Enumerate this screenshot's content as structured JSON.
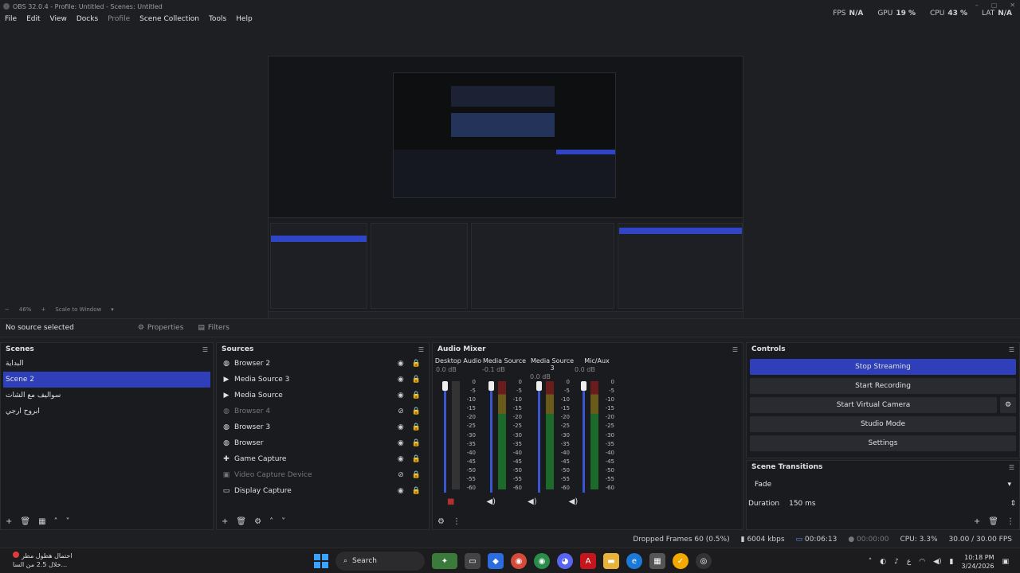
{
  "window": {
    "title": "OBS 32.0.4 - Profile: Untitled - Scenes: Untitled",
    "controls": [
      "–",
      "▢",
      "✕"
    ]
  },
  "menu": [
    "File",
    "Edit",
    "View",
    "Docks",
    "Profile",
    "Scene Collection",
    "Tools",
    "Help"
  ],
  "stats": [
    {
      "key": "FPS",
      "value": "N/A"
    },
    {
      "key": "GPU",
      "value": "19 %"
    },
    {
      "key": "CPU",
      "value": "43 %"
    },
    {
      "key": "LAT",
      "value": "N/A"
    }
  ],
  "scale": {
    "zoom": "46%",
    "mode": "Scale to Window"
  },
  "source_bar": {
    "selected": "No source selected",
    "properties": "Properties",
    "filters": "Filters"
  },
  "scenes": {
    "title": "Scenes",
    "items": [
      "البداية",
      "Scene 2",
      "سواليف مع الشات",
      "ابروح ارجي"
    ],
    "selected_index": 1
  },
  "sources": {
    "title": "Sources",
    "items": [
      {
        "name": "Browser 2",
        "icon": "globe-icon",
        "visible": true,
        "dimmed": false
      },
      {
        "name": "Media Source 3",
        "icon": "play-icon",
        "visible": true,
        "dimmed": false
      },
      {
        "name": "Media Source",
        "icon": "play-icon",
        "visible": true,
        "dimmed": false
      },
      {
        "name": "Browser 4",
        "icon": "globe-icon",
        "visible": false,
        "dimmed": true
      },
      {
        "name": "Browser 3",
        "icon": "globe-icon",
        "visible": true,
        "dimmed": false
      },
      {
        "name": "Browser",
        "icon": "globe-icon",
        "visible": true,
        "dimmed": false
      },
      {
        "name": "Game Capture",
        "icon": "gamepad-icon",
        "visible": true,
        "dimmed": false
      },
      {
        "name": "Video Capture Device",
        "icon": "camera-icon",
        "visible": false,
        "dimmed": true
      },
      {
        "name": "Display Capture",
        "icon": "monitor-icon",
        "visible": true,
        "dimmed": false
      }
    ]
  },
  "audio_mixer": {
    "title": "Audio Mixer",
    "scale": [
      "0",
      "-5",
      "-10",
      "-15",
      "-20",
      "-25",
      "-30",
      "-35",
      "-40",
      "-45",
      "-50",
      "-55",
      "-60"
    ],
    "channels": [
      {
        "name": "Desktop Audio",
        "db": "0.0 dB",
        "muted": false
      },
      {
        "name": "Media Source",
        "db": "-0.1 dB",
        "muted": false
      },
      {
        "name": "Media Source 3",
        "db": "0.0 dB",
        "muted": false
      },
      {
        "name": "Mic/Aux",
        "db": "0.0 dB",
        "muted": false
      }
    ]
  },
  "controls": {
    "title": "Controls",
    "stop_streaming": "Stop Streaming",
    "start_recording": "Start Recording",
    "start_virtual_camera": "Start Virtual Camera",
    "studio_mode": "Studio Mode",
    "settings": "Settings"
  },
  "transitions": {
    "title": "Scene Transitions",
    "selected": "Fade",
    "duration_label": "Duration",
    "duration": "150 ms"
  },
  "status": {
    "dropped": "Dropped Frames 60 (0.5%)",
    "bitrate": "6004 kbps",
    "stream_time": "00:06:13",
    "rec_time": "00:00:00",
    "cpu": "CPU: 3.3%",
    "fps": "30.00 / 30.00 FPS"
  },
  "taskbar": {
    "weather_line1": "احتمال هطول مطر",
    "weather_line2": "خلال 2.5 من السا...",
    "search": "Search",
    "time": "10:18 PM",
    "date": "3/24/2026",
    "lang": "ع"
  },
  "colors": {
    "accent": "#2f3fb9",
    "bg": "#1e1f22",
    "dock": "#1a1b1f"
  }
}
